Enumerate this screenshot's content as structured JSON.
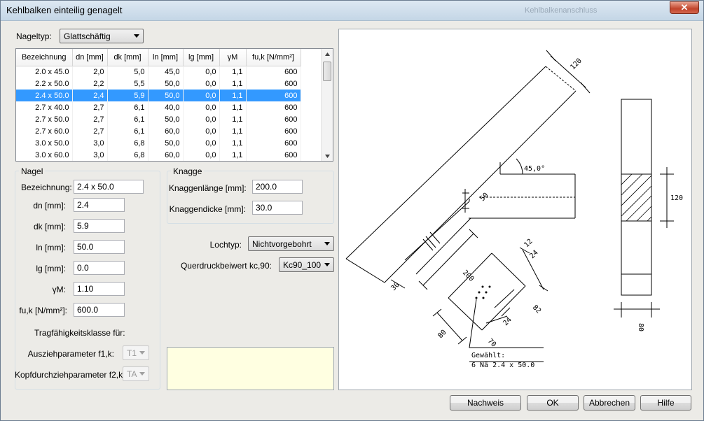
{
  "window": {
    "title": "Kehlbalken einteilig genagelt",
    "ghost_title": "Kehlbalkenanschluss"
  },
  "nageltyp": {
    "label": "Nageltyp:",
    "value": "Glattschäftig"
  },
  "table": {
    "columns": [
      "Bezeichnung",
      "dn [mm]",
      "dk [mm]",
      "ln [mm]",
      "lg [mm]",
      "γM",
      "fu,k [N/mm²]"
    ],
    "rows": [
      [
        "2.0 x 45.0",
        "2,0",
        "5,0",
        "45,0",
        "0,0",
        "1,1",
        "600"
      ],
      [
        "2.2 x 50.0",
        "2,2",
        "5,5",
        "50,0",
        "0,0",
        "1,1",
        "600"
      ],
      [
        "2.4 x 50.0",
        "2,4",
        "5,9",
        "50,0",
        "0,0",
        "1,1",
        "600"
      ],
      [
        "2.7 x 40.0",
        "2,7",
        "6,1",
        "40,0",
        "0,0",
        "1,1",
        "600"
      ],
      [
        "2.7 x 50.0",
        "2,7",
        "6,1",
        "50,0",
        "0,0",
        "1,1",
        "600"
      ],
      [
        "2.7 x 60.0",
        "2,7",
        "6,1",
        "60,0",
        "0,0",
        "1,1",
        "600"
      ],
      [
        "3.0 x 50.0",
        "3,0",
        "6,8",
        "50,0",
        "0,0",
        "1,1",
        "600"
      ],
      [
        "3.0 x 60.0",
        "3,0",
        "6,8",
        "60,0",
        "0,0",
        "1,1",
        "600"
      ]
    ],
    "selected_row": 2
  },
  "nagel": {
    "title": "Nagel",
    "bezeichnung_label": "Bezeichnung:",
    "bezeichnung": "2.4 x 50.0",
    "dn_label": "dn [mm]:",
    "dn": "2.4",
    "dk_label": "dk [mm]:",
    "dk": "5.9",
    "ln_label": "ln [mm]:",
    "ln": "50.0",
    "lg_label": "lg [mm]:",
    "lg": "0.0",
    "gm_label": "γM:",
    "gm": "1.10",
    "fuk_label": "fu,k [N/mm²]:",
    "fuk": "600.0",
    "tragklasse_label": "Tragfähigkeitsklasse für:",
    "f1_label": "Ausziehparameter f1,k:",
    "f1": "T1",
    "f2_label": "Kopfdurchziehparameter f2,k:",
    "f2": "TA"
  },
  "knagge": {
    "title": "Knagge",
    "laenge_label": "Knaggenlänge [mm]:",
    "laenge": "200.0",
    "dicke_label": "Knaggendicke [mm]:",
    "dicke": "30.0"
  },
  "lochtyp": {
    "label": "Lochtyp:",
    "value": "Nichtvorgebohrt"
  },
  "querdruck": {
    "label": "Querdruckbeiwert kc,90:",
    "value": "Kc90_100"
  },
  "drawing": {
    "dim_120_top": "120",
    "angle": "45,0°",
    "dim_50": "50",
    "dim_200": "200",
    "dim_30": "30",
    "dim_12": "12",
    "dim_24a": "24",
    "dim_82": "82",
    "dim_24b": "24",
    "dim_70": "70",
    "dim_80a": "80",
    "dim_120_side": "120",
    "dim_80_side": "80",
    "gewaehlt_label": "Gewählt:",
    "gewaehlt_value": "6 Nä 2.4 x 50.0"
  },
  "buttons": {
    "nachweis": "Nachweis",
    "ok": "OK",
    "abbrechen": "Abbrechen",
    "hilfe": "Hilfe"
  }
}
